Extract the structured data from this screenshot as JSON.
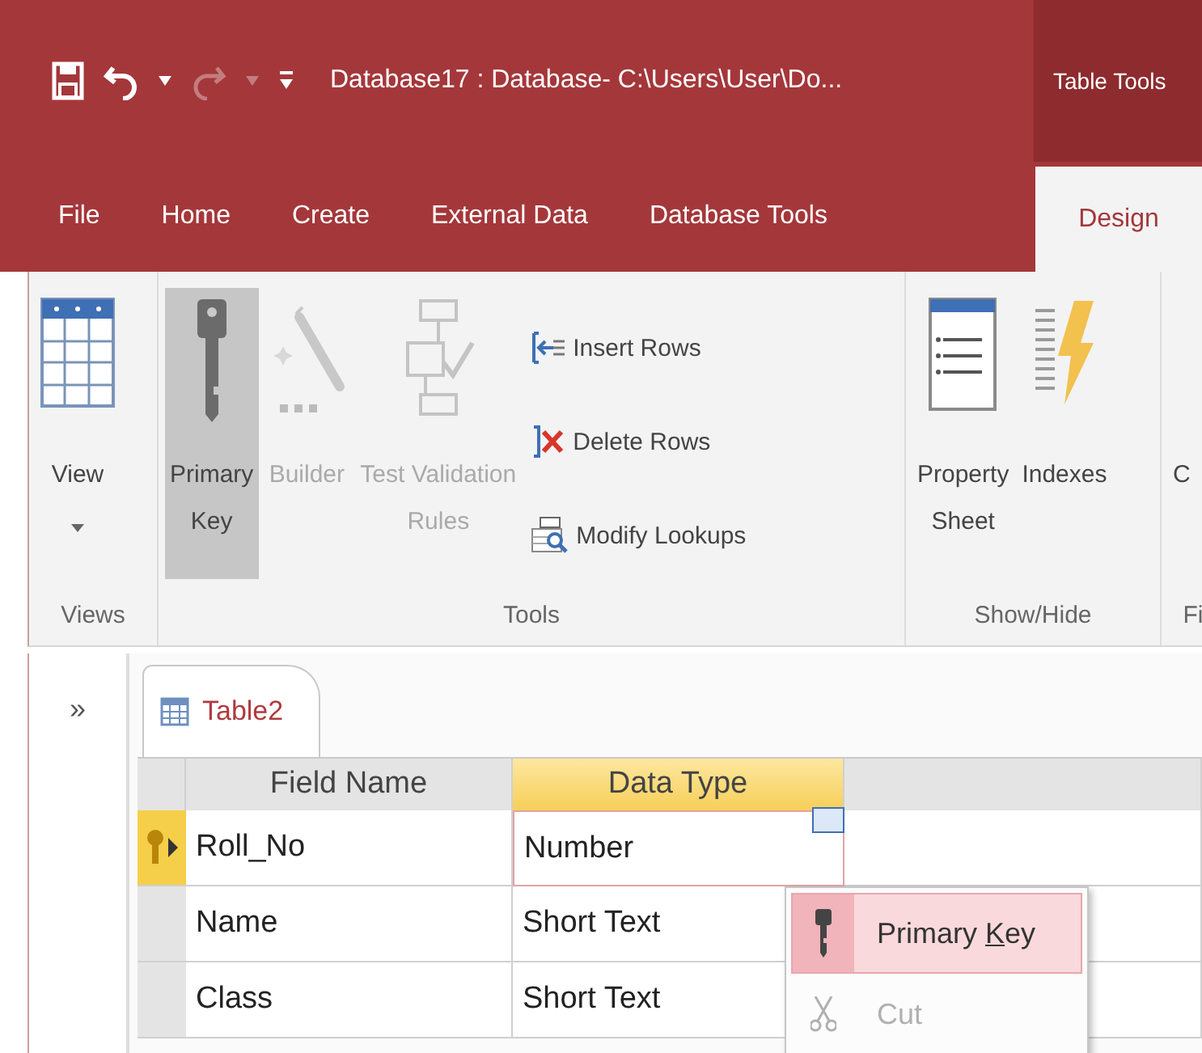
{
  "quick_access": [
    {
      "kind": "save",
      "disabled": false
    },
    {
      "kind": "undo",
      "disabled": false
    },
    {
      "kind": "menu",
      "disabled": false
    },
    {
      "kind": "redo",
      "disabled": true
    },
    {
      "kind": "menu",
      "disabled": true
    },
    {
      "kind": "customize",
      "disabled": false
    }
  ],
  "window": {
    "title": "Database17 : Database- C:\\Users\\User\\Do...",
    "contextual_group": "Table Tools"
  },
  "tabs": [
    {
      "label": "File",
      "selected": false
    },
    {
      "label": "Home",
      "selected": false
    },
    {
      "label": "Create",
      "selected": false
    },
    {
      "label": "External Data",
      "selected": false
    },
    {
      "label": "Database Tools",
      "selected": false
    },
    {
      "label": "Design",
      "selected": true
    }
  ],
  "ribbon": {
    "groups": [
      {
        "label": "Views",
        "buttons": [
          {
            "kind": "large",
            "lines": [
              "View"
            ],
            "dropdown": true,
            "disabled": false,
            "selected": false
          }
        ]
      },
      {
        "label": "Tools",
        "buttons": [
          {
            "kind": "large",
            "lines": [
              "Primary",
              "Key"
            ],
            "dropdown": false,
            "disabled": false,
            "selected": true
          },
          {
            "kind": "large",
            "lines": [
              "Builder"
            ],
            "dropdown": false,
            "disabled": true,
            "selected": false
          },
          {
            "kind": "large",
            "lines": [
              "Test Validation",
              "Rules"
            ],
            "dropdown": false,
            "disabled": true,
            "selected": false
          },
          {
            "kind": "small",
            "lines": [
              "Insert Rows"
            ],
            "disabled": false
          },
          {
            "kind": "small",
            "lines": [
              "Delete Rows"
            ],
            "disabled": false
          },
          {
            "kind": "small",
            "lines": [
              "Modify Lookups"
            ],
            "disabled": false
          }
        ]
      },
      {
        "label": "Show/Hide",
        "buttons": [
          {
            "kind": "large",
            "lines": [
              "Property",
              "Sheet"
            ],
            "dropdown": false,
            "disabled": false,
            "selected": false
          },
          {
            "kind": "large",
            "lines": [
              "Indexes"
            ],
            "dropdown": false,
            "disabled": false,
            "selected": false
          }
        ]
      },
      {
        "label": "Fi",
        "buttons": [
          {
            "kind": "large",
            "lines": [
              "C"
            ],
            "dropdown": false,
            "disabled": false,
            "selected": false
          }
        ]
      }
    ]
  },
  "nav_pane": {
    "toggle": "»"
  },
  "document_tabs": [
    {
      "label": "Table2",
      "selected": true
    }
  ],
  "table": {
    "columns": [
      {
        "label": "Field Name",
        "selected": false
      },
      {
        "label": "Data Type",
        "selected": true
      }
    ],
    "rows": [
      {
        "field_name": "Roll_No",
        "data_type": "Number",
        "primary_key": true,
        "current": true
      },
      {
        "field_name": "Name",
        "data_type": "Short Text",
        "primary_key": false,
        "current": false
      },
      {
        "field_name": "Class",
        "data_type": "Short Text",
        "primary_key": false,
        "current": false
      }
    ]
  },
  "context_menu": {
    "items": [
      {
        "label_before": "Primary ",
        "access_key": "K",
        "label_after": "ey",
        "highlighted": true,
        "disabled": false
      },
      {
        "label_before": "Cut",
        "highlighted": false,
        "disabled": true
      }
    ]
  }
}
